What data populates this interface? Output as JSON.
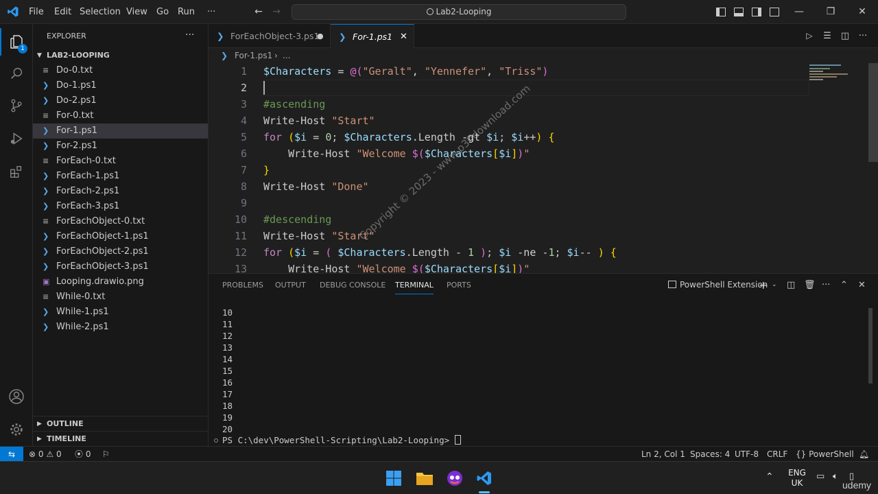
{
  "menu": [
    "File",
    "Edit",
    "Selection",
    "View",
    "Go",
    "Run",
    "···"
  ],
  "search": {
    "text": "Lab2-Looping"
  },
  "explorer": {
    "title": "EXPLORER",
    "folder": "LAB2-LOOPING",
    "files": [
      {
        "name": "Do-0.txt",
        "type": "txt"
      },
      {
        "name": "Do-1.ps1",
        "type": "ps1"
      },
      {
        "name": "Do-2.ps1",
        "type": "ps1"
      },
      {
        "name": "For-0.txt",
        "type": "txt"
      },
      {
        "name": "For-1.ps1",
        "type": "ps1",
        "selected": true
      },
      {
        "name": "For-2.ps1",
        "type": "ps1"
      },
      {
        "name": "ForEach-0.txt",
        "type": "txt"
      },
      {
        "name": "ForEach-1.ps1",
        "type": "ps1"
      },
      {
        "name": "ForEach-2.ps1",
        "type": "ps1"
      },
      {
        "name": "ForEach-3.ps1",
        "type": "ps1"
      },
      {
        "name": "ForEachObject-0.txt",
        "type": "txt"
      },
      {
        "name": "ForEachObject-1.ps1",
        "type": "ps1"
      },
      {
        "name": "ForEachObject-2.ps1",
        "type": "ps1"
      },
      {
        "name": "ForEachObject-3.ps1",
        "type": "ps1"
      },
      {
        "name": "Looping.drawio.png",
        "type": "png"
      },
      {
        "name": "While-0.txt",
        "type": "txt"
      },
      {
        "name": "While-1.ps1",
        "type": "ps1"
      },
      {
        "name": "While-2.ps1",
        "type": "ps1"
      }
    ],
    "outline": "OUTLINE",
    "timeline": "TIMELINE",
    "badge": "1"
  },
  "tabs": [
    {
      "label": "ForEachObject-3.ps1",
      "modified": true
    },
    {
      "label": "For-1.ps1",
      "active": true
    }
  ],
  "breadcrumb": {
    "file": "For-1.ps1",
    "rest": "..."
  },
  "code_lines": [
    {
      "n": "1"
    },
    {
      "n": "2"
    },
    {
      "n": "3"
    },
    {
      "n": "4"
    },
    {
      "n": "5"
    },
    {
      "n": "6"
    },
    {
      "n": "7"
    },
    {
      "n": "8"
    },
    {
      "n": "9"
    },
    {
      "n": "10"
    },
    {
      "n": "11"
    },
    {
      "n": "12"
    },
    {
      "n": "13"
    }
  ],
  "panel": {
    "tabs": [
      "PROBLEMS",
      "OUTPUT",
      "DEBUG CONSOLE",
      "TERMINAL",
      "PORTS"
    ],
    "active": "TERMINAL",
    "shell": "PowerShell Extension",
    "output": [
      "10",
      "11",
      "12",
      "13",
      "14",
      "15",
      "16",
      "17",
      "18",
      "19",
      "20"
    ],
    "prompt": "PS C:\\dev\\PowerShell-Scripting\\Lab2-Looping> "
  },
  "status": {
    "errors": "0",
    "warnings": "0",
    "ports": "0",
    "position": "Ln 2, Col 1",
    "spaces": "Spaces: 4",
    "encoding": "UTF-8",
    "eol": "CRLF",
    "lang": "PowerShell"
  },
  "taskbar": {
    "lang": "ENG",
    "region": "UK",
    "brand": "udemy"
  },
  "watermark": "Copyright © 2023 - www.p30download.com",
  "colors": {
    "accent": "#0078d4",
    "ps_icon": "#5aa7e6"
  }
}
